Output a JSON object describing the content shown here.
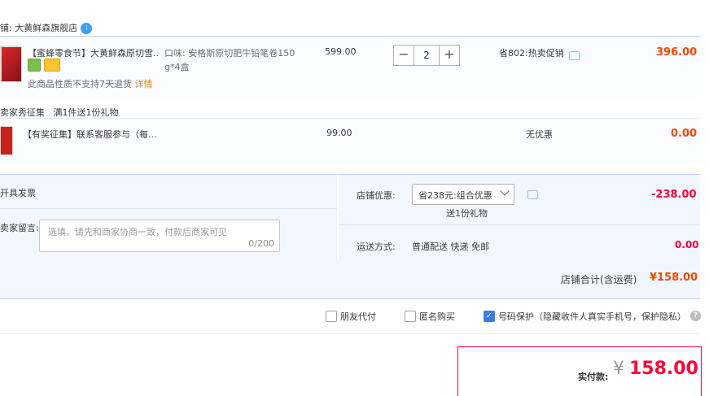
{
  "store": {
    "label": "铺: 大黄鲜森旗舰店",
    "badge": "i"
  },
  "item1": {
    "title": "【蜜蜂零食节】大黄鲜森原切雪...",
    "sku": "口味: 安格斯原切肥牛铅笔卷150g*4盒",
    "sku_line1": "口味: 安格斯原切肥牛铅笔卷150",
    "sku_line2": "g*4盒",
    "notice": "此商品性质不支持7天退货",
    "notice_link": "详情",
    "unit_price": "599.00",
    "qty": "2",
    "minus": "−",
    "plus": "+",
    "promo": "省802:热卖促销",
    "subtotal": "396.00"
  },
  "gift_header": "卖家秀征集   满1件送1份礼物",
  "item2": {
    "title": "【有奖征集】联系客服参与（每...",
    "unit_price": "99.00",
    "promo": "无优惠",
    "subtotal": "0.00"
  },
  "invoice_label": "开具发票",
  "message": {
    "label": "卖家留言:",
    "placeholder": "选填，请先和商家协商一致，付款后商家可见",
    "counter": "0/200"
  },
  "store_discount": {
    "label": "店铺优惠:",
    "selected": "省238元:组合优惠",
    "gift": "送1份礼物",
    "amount": "-238.00"
  },
  "shipping": {
    "label": "运送方式:",
    "method": "普通配送 快递 免邮",
    "amount": "0.00"
  },
  "store_total": {
    "label": "店铺合计(含运费)",
    "amount": "¥158.00"
  },
  "options": {
    "friend_pay": "朋友代付",
    "anonymous": "匿名购买",
    "privacy": "号码保护（隐藏收件人真实手机号，保护隐私）",
    "help": "?"
  },
  "payment": {
    "label": "实付款:",
    "currency": "¥",
    "amount": "158.00"
  },
  "colors": {
    "accent_red": "#ff0036",
    "price_orange": "#ff4400",
    "panel_blue": "#f2f7ff",
    "checkbox_blue": "#3b7bea"
  }
}
